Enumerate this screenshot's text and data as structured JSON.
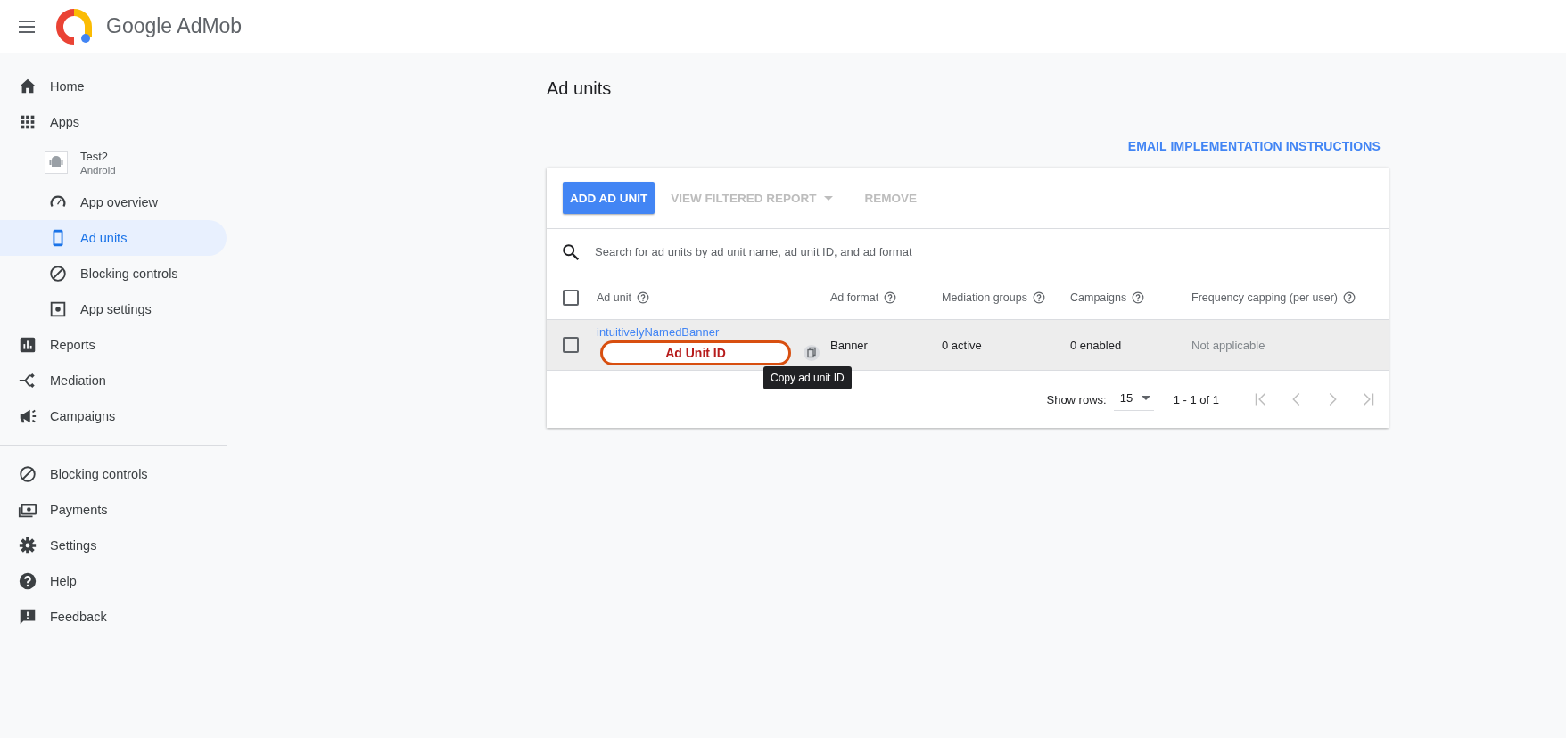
{
  "header": {
    "product": "Google AdMob"
  },
  "sidebar": {
    "sections": [
      {
        "items": [
          {
            "kind": "nav",
            "label": "Home",
            "selected": false
          },
          {
            "kind": "nav",
            "label": "Apps",
            "selected": false,
            "children": [
              {
                "kind": "app",
                "label": "Test2",
                "platform": "Android",
                "selected": false
              },
              {
                "kind": "nav",
                "label": "App overview",
                "selected": false
              },
              {
                "kind": "nav",
                "label": "Ad units",
                "selected": true
              },
              {
                "kind": "nav",
                "label": "Blocking controls",
                "selected": false
              },
              {
                "kind": "nav",
                "label": "App settings",
                "selected": false
              }
            ]
          },
          {
            "kind": "nav",
            "label": "Reports",
            "selected": false
          },
          {
            "kind": "nav",
            "label": "Mediation",
            "selected": false
          },
          {
            "kind": "nav",
            "label": "Campaigns",
            "selected": false
          }
        ]
      },
      {
        "items": [
          {
            "kind": "nav",
            "label": "Blocking controls",
            "selected": false
          },
          {
            "kind": "nav",
            "label": "Payments",
            "selected": false
          },
          {
            "kind": "nav",
            "label": "Settings",
            "selected": false
          },
          {
            "kind": "nav",
            "label": "Help",
            "selected": false
          },
          {
            "kind": "nav",
            "label": "Feedback",
            "selected": false
          }
        ]
      }
    ]
  },
  "page": {
    "title": "Ad units",
    "link": "EMAIL IMPLEMENTATION INSTRUCTIONS"
  },
  "toolbar": {
    "buttons": [
      {
        "kind": "raised",
        "label": "ADD AD UNIT",
        "disabled": false
      },
      {
        "kind": "menu",
        "label": "VIEW FILTERED REPORT",
        "disabled": true
      },
      {
        "kind": "flat",
        "label": "REMOVE",
        "disabled": true
      }
    ]
  },
  "search": {
    "placeholder": "Search for ad units by ad unit name, ad unit ID, and ad format"
  },
  "table": {
    "select_all_checked": false,
    "columns": [
      "Ad unit",
      "Ad format",
      "Mediation groups",
      "Campaigns",
      "Frequency capping (per user)"
    ],
    "rows": [
      {
        "checked": false,
        "highlighted": true,
        "name": "intuitivelyNamedBanner",
        "annotation": "Ad Unit ID",
        "tooltip": "Copy ad unit ID",
        "format": "Banner",
        "mediation": "0 active",
        "campaigns": "0 enabled",
        "frequency": "Not applicable",
        "frequency_disabled": true
      }
    ]
  },
  "pagination": {
    "label": "Show rows:",
    "rows_value": "15",
    "range": "1 - 1 of 1"
  }
}
